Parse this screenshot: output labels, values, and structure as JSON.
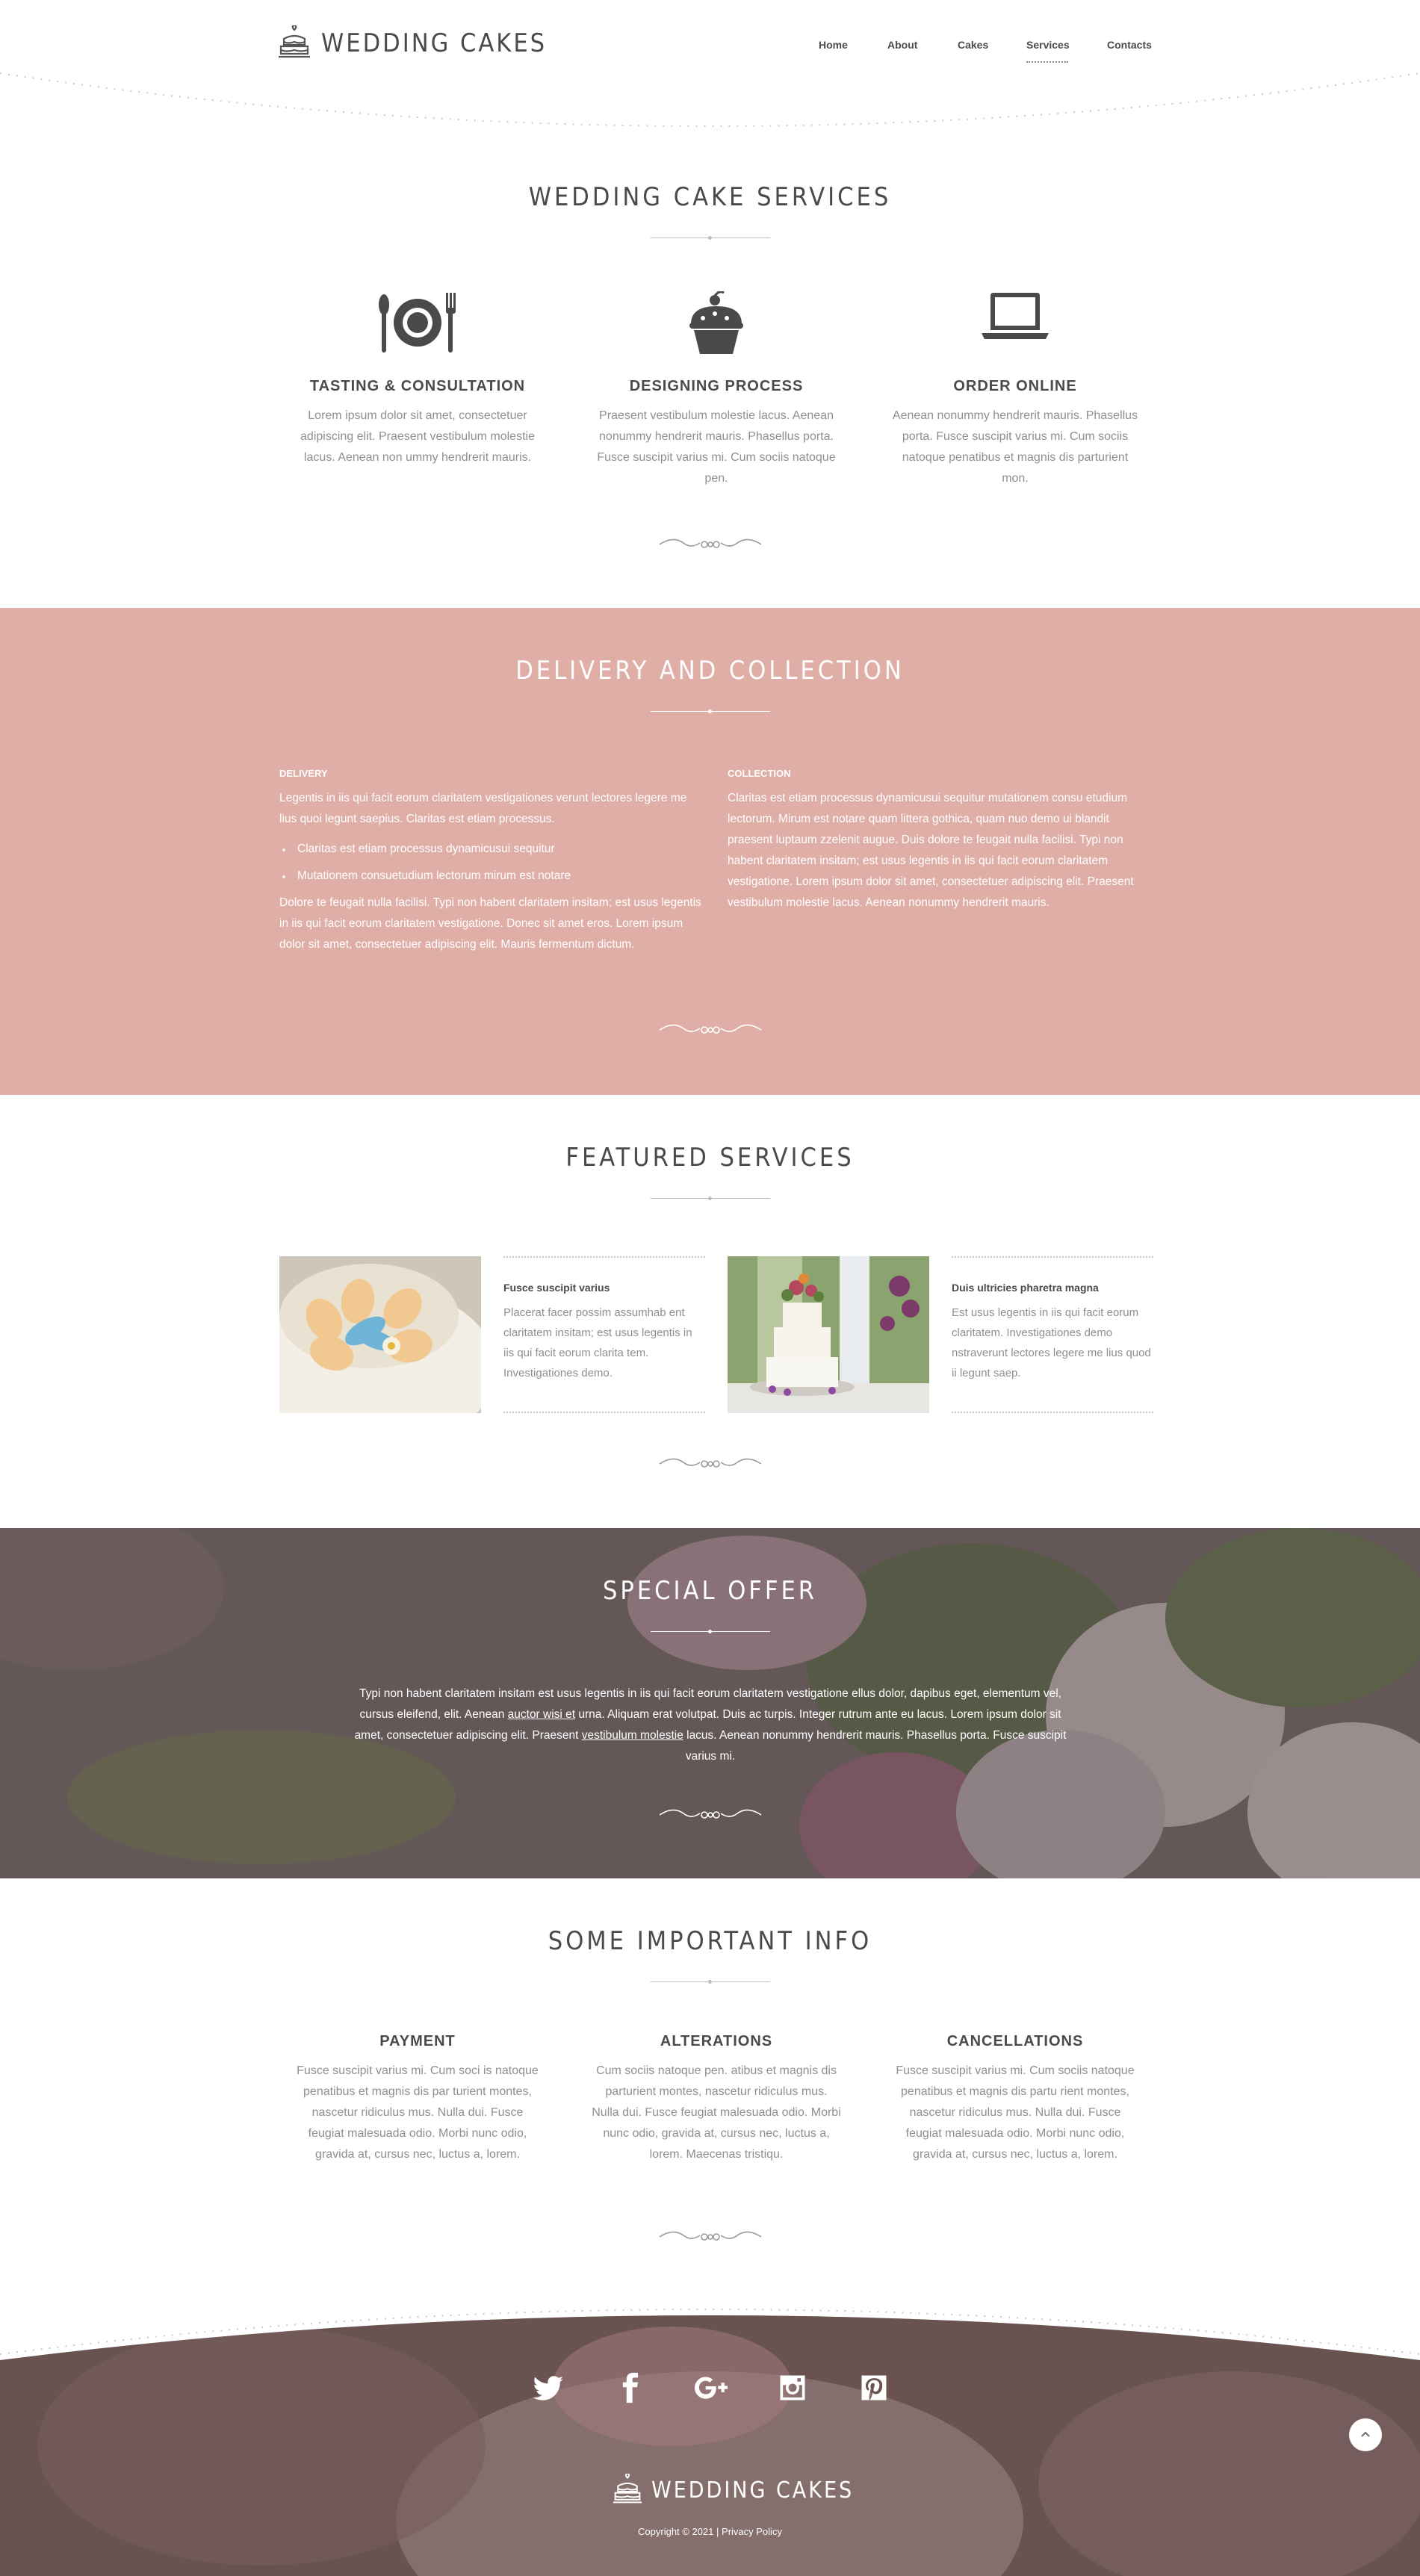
{
  "brand": {
    "name": "WEDDING CAKES",
    "logo_icon": "cake-icon"
  },
  "nav": {
    "items": [
      "Home",
      "About",
      "Cakes",
      "Services",
      "Contacts"
    ],
    "active": "Services"
  },
  "services": {
    "title": "WEDDING CAKE SERVICES",
    "items": [
      {
        "icon": "plate-cutlery-icon",
        "title": "TASTING & CONSULTATION",
        "text": "Lorem ipsum dolor sit amet, consectetuer adipiscing elit. Praesent vestibulum molestie lacus. Aenean non ummy hendrerit mauris."
      },
      {
        "icon": "cupcake-icon",
        "title": "DESIGNING PROCESS",
        "text": "Praesent vestibulum molestie lacus. Aenean nonummy hendrerit mauris. Phasellus porta. Fusce suscipit varius mi. Cum sociis natoque pen."
      },
      {
        "icon": "laptop-icon",
        "title": "ORDER ONLINE",
        "text": "Aenean nonummy hendrerit mauris. Phasellus porta. Fusce suscipit varius mi. Cum sociis natoque penatibus et magnis dis parturient mon."
      }
    ]
  },
  "delivery": {
    "title": "DELIVERY AND COLLECTION",
    "color": "#dfaea7",
    "delivery_heading": "DELIVERY",
    "delivery_intro": "Legentis in iis qui facit eorum claritatem vestigationes verunt lectores legere me lius quoi legunt saepius. Claritas est etiam processus.",
    "delivery_bullets": [
      "Claritas est etiam processus dynamicusui sequitur",
      "Mutationem consuetudium lectorum mirum est notare"
    ],
    "delivery_outro": "Dolore te feugait nulla facilisi. Typi non habent claritatem insitam; est usus legentis in iis qui facit eorum claritatem vestigatione. Donec sit amet eros. Lorem ipsum dolor sit amet, consectetuer adipiscing elit. Mauris fermentum dictum.",
    "collection_heading": "COLLECTION",
    "collection_text": "Claritas est etiam processus dynamicusui sequitur mutationem consu etudium lectorum. Mirum est notare quam littera gothica, quam nuo demo ui blandit praesent luptaum zzelenit augue. Duis dolore te feugait nulla facilisi. Typi non habent claritatem insitam; est usus legentis in iis qui facit eorum claritatem vestigatione. Lorem ipsum dolor sit amet, consectetuer adipiscing elit. Praesent vestibulum molestie lacus. Aenean nonummy hendrerit mauris."
  },
  "featured": {
    "title": "FEATURED SERVICES",
    "items": [
      {
        "image": "cake-with-blue-flower-photo",
        "heading": "Fusce suscipit varius",
        "text": "Placerat facer possim assumhab ent claritatem insitam; est usus legentis in iis qui facit eorum clarita tem. Investigationes demo."
      },
      {
        "image": "white-wedding-cake-flowers-photo",
        "heading": "Duis ultricies pharetra magna",
        "text": "Est usus legentis in iis qui facit eorum claritatem. Investigationes demo nstraverunt lectores legere me lius quod ii legunt saep."
      }
    ]
  },
  "offer": {
    "title": "SPECIAL OFFER",
    "text_1": "Typi non habent claritatem insitam est usus legentis in iis qui facit eorum claritatem vestigatione ellus dolor, dapibus eget, elementum vel, cursus eleifend, elit. Aenean ",
    "link_1": "auctor wisi et",
    "text_2": " urna. Aliquam erat volutpat. Duis ac turpis. Integer rutrum ante eu lacus. Lorem ipsum dolor sit amet, consectetuer adipiscing elit. Praesent ",
    "link_2": "vestibulum molestie",
    "text_3": " lacus. Aenean nonummy hendrerit mauris. Phasellus porta. Fusce suscipit varius mi."
  },
  "info": {
    "title": "SOME IMPORTANT INFO",
    "items": [
      {
        "title": "PAYMENT",
        "text": "Fusce suscipit varius mi. Cum soci is natoque penatibus et magnis dis par turient montes, nascetur ridiculus mus. Nulla dui. Fusce feugiat malesuada odio. Morbi nunc odio, gravida at, cursus nec, luctus a, lorem."
      },
      {
        "title": "ALTERATIONS",
        "text": "Cum sociis natoque pen. atibus et magnis dis parturient montes, nascetur ridiculus mus. Nulla dui. Fusce feugiat malesuada odio. Morbi nunc odio, gravida at, cursus nec, luctus a, lorem. Maecenas tristiqu."
      },
      {
        "title": "CANCELLATIONS",
        "text": "Fusce suscipit varius mi. Cum sociis natoque penatibus et magnis dis partu rient montes, nascetur ridiculus mus. Nulla dui. Fusce feugiat malesuada odio. Morbi nunc odio, gravida at, cursus nec, luctus a, lorem."
      }
    ]
  },
  "footer": {
    "social": [
      "twitter-icon",
      "facebook-icon",
      "google-plus-icon",
      "instagram-icon",
      "pinterest-icon"
    ],
    "brand": "WEDDING CAKES",
    "copyright": "Copyright © 2021",
    "separator": "|",
    "privacy": "Privacy Policy",
    "scroll_top_icon": "chevron-up-icon"
  }
}
